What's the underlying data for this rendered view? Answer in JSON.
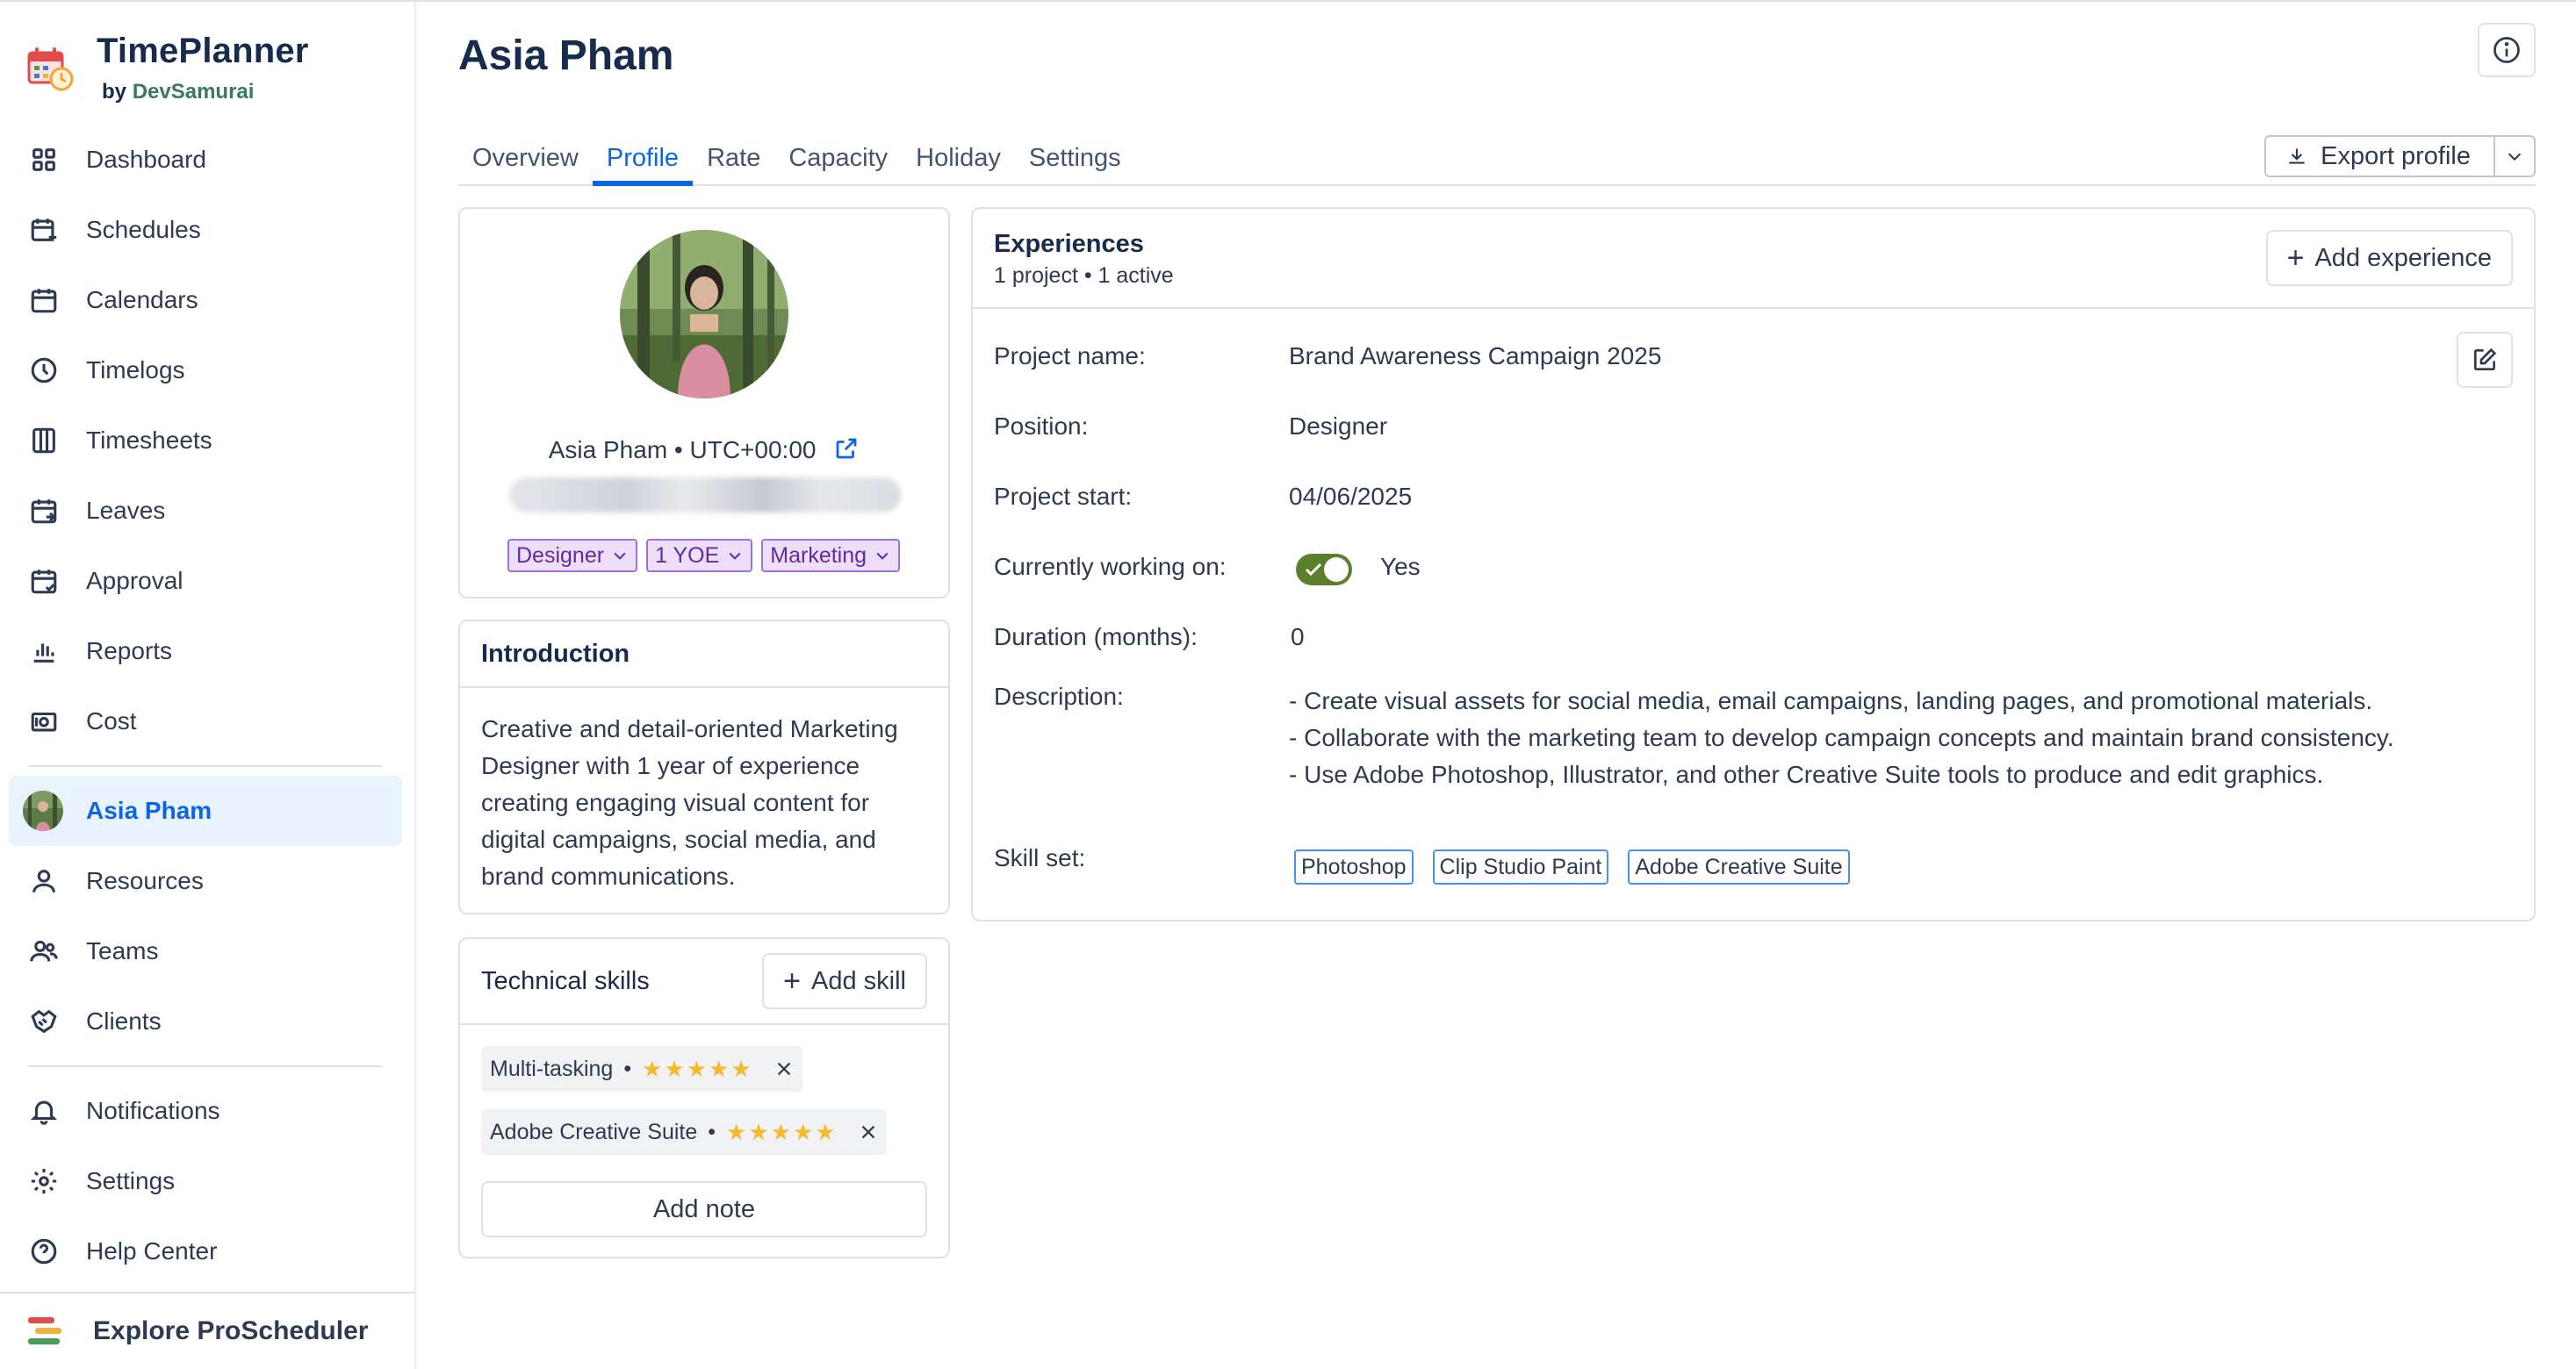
{
  "brand": {
    "title": "TimePlanner",
    "by": "by",
    "company": "DevSamurai"
  },
  "sidebar": {
    "items": [
      {
        "label": "Dashboard",
        "icon": "grid-icon"
      },
      {
        "label": "Schedules",
        "icon": "calendar-plus-icon"
      },
      {
        "label": "Calendars",
        "icon": "calendar-icon"
      },
      {
        "label": "Timelogs",
        "icon": "clock-icon"
      },
      {
        "label": "Timesheets",
        "icon": "columns-icon"
      },
      {
        "label": "Leaves",
        "icon": "calendar-leave-icon"
      },
      {
        "label": "Approval",
        "icon": "calendar-check-icon"
      },
      {
        "label": "Reports",
        "icon": "bar-chart-icon"
      },
      {
        "label": "Cost",
        "icon": "money-icon"
      }
    ],
    "user": {
      "label": "Asia Pham"
    },
    "items2": [
      {
        "label": "Resources",
        "icon": "user-icon"
      },
      {
        "label": "Teams",
        "icon": "users-icon"
      },
      {
        "label": "Clients",
        "icon": "handshake-icon"
      }
    ],
    "items3": [
      {
        "label": "Notifications",
        "icon": "bell-icon"
      },
      {
        "label": "Settings",
        "icon": "gear-icon"
      },
      {
        "label": "Help Center",
        "icon": "help-icon"
      }
    ],
    "explore": "Explore ProScheduler"
  },
  "page": {
    "title": "Asia Pham"
  },
  "tabs": [
    "Overview",
    "Profile",
    "Rate",
    "Capacity",
    "Holiday",
    "Settings"
  ],
  "active_tab": "Profile",
  "export_label": "Export profile",
  "profile": {
    "name_line": "Asia Pham • UTC+00:00",
    "tags": [
      "Designer",
      "1 YOE",
      "Marketing"
    ],
    "tag_color": "#eddffc"
  },
  "introduction": {
    "title": "Introduction",
    "text": "Creative and detail-oriented Marketing Designer with 1 year of experience creating engaging visual content for digital campaigns, social media, and brand communications."
  },
  "technical_skills": {
    "title": "Technical skills",
    "add_label": "Add skill",
    "skills": [
      {
        "name": "Multi-tasking",
        "rating": 5
      },
      {
        "name": "Adobe Creative Suite",
        "rating": 5
      }
    ],
    "add_note": "Add note"
  },
  "experiences": {
    "title": "Experiences",
    "subtitle": "1 project • 1 active",
    "add_label": "Add experience",
    "fields": {
      "project_name_label": "Project name:",
      "project_name": "Brand Awareness Campaign 2025",
      "position_label": "Position:",
      "position": "Designer",
      "project_start_label": "Project start:",
      "project_start": "04/06/2025",
      "working_label": "Currently working on:",
      "working_value": "Yes",
      "duration_label": "Duration (months):",
      "duration": "0",
      "description_label": "Description:",
      "description": [
        "- Create visual assets for social media, email campaigns, landing pages, and promotional materials.",
        "- Collaborate with the marketing team to develop campaign concepts and maintain brand consistency.",
        "- Use Adobe Photoshop, Illustrator, and other Creative Suite tools to produce and edit graphics."
      ],
      "skillset_label": "Skill set:",
      "skillset": [
        "Photoshop",
        "Clip Studio Paint",
        "Adobe Creative Suite"
      ]
    },
    "toggle_color": "#5b7f2b"
  }
}
